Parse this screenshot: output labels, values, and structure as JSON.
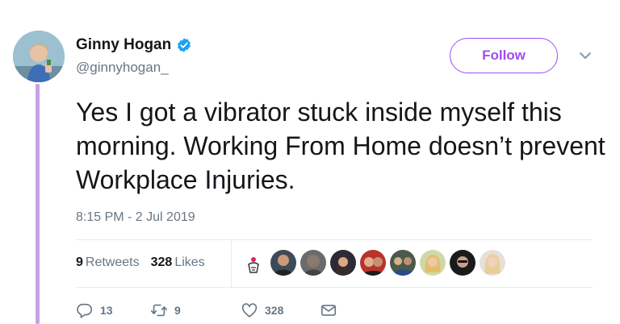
{
  "author": {
    "display_name": "Ginny Hogan",
    "handle": "@ginnyhogan_",
    "verified": true,
    "avatar_icon": "avatar-photo"
  },
  "follow_label": "Follow",
  "tweet": {
    "text": "Yes I got a vibrator stuck inside myself this morning. Working From Home doesn’t prevent Workplace Injuries.",
    "timestamp": "8:15 PM - 2 Jul 2019"
  },
  "stats": {
    "retweets_count": "9",
    "retweets_label": "Retweets",
    "likes_count": "328",
    "likes_label": "Likes"
  },
  "likers": [
    {
      "icon": "sticker-avatar"
    },
    {
      "icon": "user-avatar"
    },
    {
      "icon": "user-avatar"
    },
    {
      "icon": "user-avatar"
    },
    {
      "icon": "user-avatar"
    },
    {
      "icon": "user-avatar"
    },
    {
      "icon": "user-avatar"
    },
    {
      "icon": "user-avatar"
    },
    {
      "icon": "user-avatar"
    }
  ],
  "actions": {
    "reply_count": "13",
    "retweet_count": "9",
    "like_count": "328"
  },
  "colors": {
    "accent": "#9f4ef0",
    "thread_line": "#c8a2e8",
    "verified": "#1da1f2",
    "muted": "#657786",
    "text": "#14171a"
  }
}
